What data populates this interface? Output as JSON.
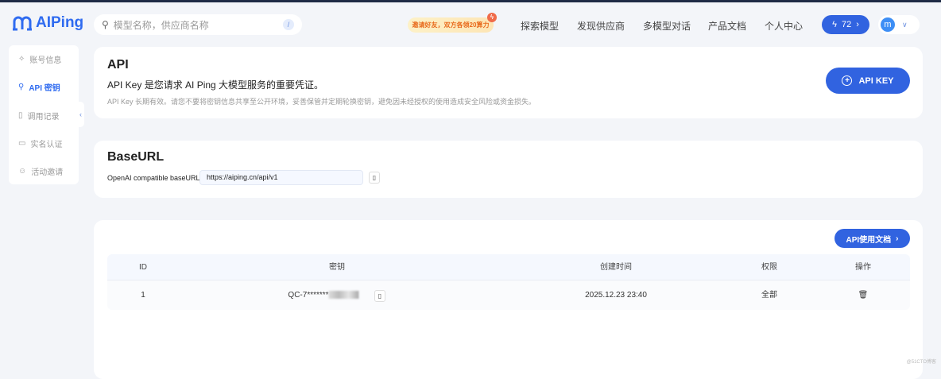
{
  "header": {
    "logo": "AIPing",
    "search_placeholder": "模型名称，供应商名称",
    "search_shortcut": "/",
    "promo": "邀请好友，双方各领20算力",
    "nav": [
      "探索模型",
      "发现供应商",
      "多模型对话",
      "产品文档",
      "个人中心"
    ],
    "credits": "72",
    "avatar_letter": "m"
  },
  "sidebar": {
    "items": [
      {
        "label": "账号信息",
        "icon": "✧"
      },
      {
        "label": "API 密钥",
        "icon": "⚲"
      },
      {
        "label": "调用记录",
        "icon": "▯"
      },
      {
        "label": "实名认证",
        "icon": "▭"
      },
      {
        "label": "活动邀请",
        "icon": "☺"
      }
    ],
    "active": 1
  },
  "api": {
    "title": "API",
    "desc": "API Key 是您请求 AI Ping 大模型服务的重要凭证。",
    "note": "API Key 长期有效。请您不要将密钥信息共享至公开环境，妥善保管并定期轮换密钥，避免因未经授权的使用造成安全风险或资金损失。",
    "button": "API KEY"
  },
  "baseurl": {
    "title": "BaseURL",
    "label": "OpenAI compatible baseURL:",
    "value": "https://aiping.cn/api/v1"
  },
  "keys": {
    "doc_button": "API使用文档",
    "columns": [
      "ID",
      "密钥",
      "创建时间",
      "权限",
      "操作"
    ],
    "rows": [
      {
        "id": "1",
        "key": "QC-7*******",
        "created": "2025.12.23 23:40",
        "permission": "全部"
      }
    ]
  },
  "watermark": "@51CTO博客"
}
